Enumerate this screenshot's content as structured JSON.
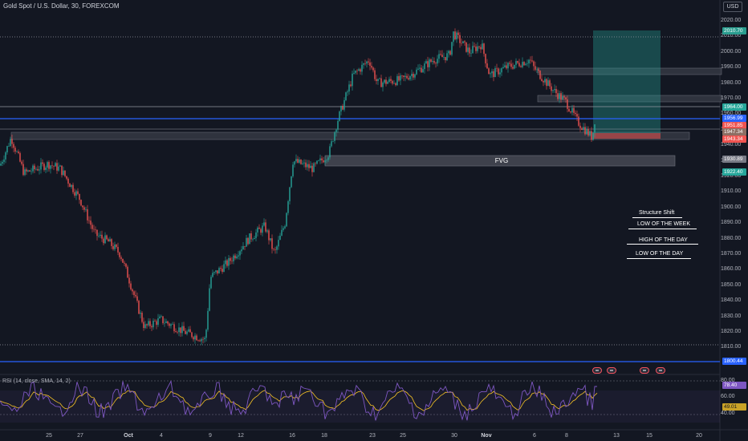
{
  "header": {
    "symbol_title": "Gold Spot / U.S. Dollar, 30, FOREXCOM",
    "currency_button": "USD"
  },
  "price_axis": {
    "ticks": [
      "2020.00",
      "2010.00",
      "2000.00",
      "1990.00",
      "1980.00",
      "1970.00",
      "1960.00",
      "1950.00",
      "1940.00",
      "1930.00",
      "1920.00",
      "1910.00",
      "1900.00",
      "1890.00",
      "1880.00",
      "1870.00",
      "1860.00",
      "1850.00",
      "1840.00",
      "1830.00",
      "1820.00",
      "1810.00"
    ]
  },
  "price_badges": [
    {
      "text": "2010.70",
      "color": "#2a9d8f"
    },
    {
      "text": "1964.00",
      "color": "#26a69a"
    },
    {
      "text": "1956.99",
      "color": "#2962ff"
    },
    {
      "text": "1951.85",
      "color": "#ef5350"
    },
    {
      "text": "1947.34",
      "color": "#8d6e63"
    },
    {
      "text": "1943.34",
      "color": "#ef5350"
    },
    {
      "text": "1930.89",
      "color": "#787b86"
    },
    {
      "text": "1922.40",
      "color": "#26a69a"
    },
    {
      "text": "1800.44",
      "color": "#2962ff"
    }
  ],
  "time_axis": {
    "ticks": [
      {
        "text": "25",
        "bold": false
      },
      {
        "text": "27",
        "bold": false
      },
      {
        "text": "Oct",
        "bold": true
      },
      {
        "text": "4",
        "bold": false
      },
      {
        "text": "9",
        "bold": false
      },
      {
        "text": "12",
        "bold": false
      },
      {
        "text": "16",
        "bold": false
      },
      {
        "text": "18",
        "bold": false
      },
      {
        "text": "23",
        "bold": false
      },
      {
        "text": "25",
        "bold": false
      },
      {
        "text": "30",
        "bold": false
      },
      {
        "text": "Nov",
        "bold": true
      },
      {
        "text": "6",
        "bold": false
      },
      {
        "text": "8",
        "bold": false
      },
      {
        "text": "13",
        "bold": false
      },
      {
        "text": "15",
        "bold": false
      },
      {
        "text": "20",
        "bold": false
      }
    ]
  },
  "rsi": {
    "label": "RSI (14, close, SMA, 14, 2)",
    "ticks": [
      "80.00",
      "60.00",
      "40.00"
    ],
    "value_badge": "78.40",
    "sma_badge": "49.01"
  },
  "annotations": {
    "fvg": "FVG",
    "structure_shift": "Structure Shift",
    "low_of_week": "LOW OF THE WEEK",
    "high_of_day": "HIGH OF THE DAY",
    "low_of_day": "LOW OF THE DAY"
  },
  "colors": {
    "background": "#131722",
    "bull_candle": "#26a69a",
    "bear_candle": "#ef5350",
    "blue_line": "#2962ff",
    "rsi_line": "#7e57c2",
    "rsi_sma": "#f7c325",
    "target_zone": "#26a69a",
    "stop_zone": "#ef5350"
  }
}
